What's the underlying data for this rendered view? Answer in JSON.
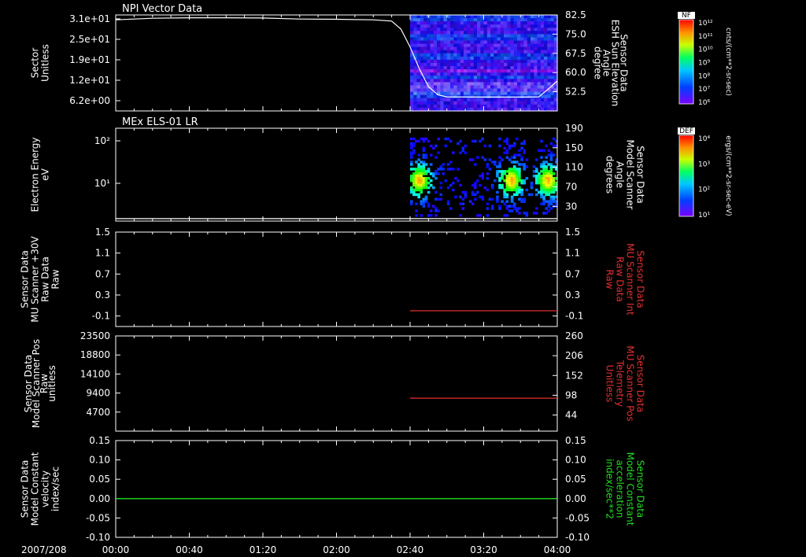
{
  "colors": {
    "background": "#000000",
    "axis": "#ffffff",
    "red": "#e03030",
    "green": "#22dd22"
  },
  "time_axis": {
    "date_label": "2007/208",
    "ticks": [
      "00:00",
      "00:40",
      "01:20",
      "02:00",
      "02:40",
      "03:20",
      "04:00"
    ]
  },
  "colorbars": [
    {
      "tag": "NF",
      "scale": "log",
      "tick_labels": [
        "10¹²",
        "10¹¹",
        "10¹⁰",
        "10⁹",
        "10⁸",
        "10⁷",
        "10⁶"
      ],
      "units": "cnts/(cm**2-sr-sec)"
    },
    {
      "tag": "DEF",
      "scale": "log",
      "tick_labels": [
        "10⁴",
        "10³",
        "10²",
        "10¹"
      ],
      "units": "ergs/(cm**2-sr-sec-eV)"
    }
  ],
  "chart_data": [
    {
      "type": "heatmap",
      "title": "NPI Vector Data",
      "left_axis": {
        "label_lines": [
          "Sector",
          "Unitless"
        ],
        "ticks": [
          "3.1e+01",
          "2.5e+01",
          "1.9e+01",
          "1.2e+01",
          "6.2e+00"
        ]
      },
      "right_axis": {
        "label_lines": [
          "Sensor Data",
          "ESH Sun Elevation",
          "Angle",
          "degree"
        ],
        "ticks": [
          "82.5",
          "75.0",
          "67.5",
          "60.0",
          "52.5"
        ],
        "ylim": [
          45.0,
          82.5
        ]
      },
      "data_start": "02:40",
      "line_series": {
        "name": "ESH Sun Elevation Angle",
        "axis": "right",
        "points": [
          [
            "00:00",
            80.6
          ],
          [
            "00:20",
            81.2
          ],
          [
            "00:40",
            81.4
          ],
          [
            "01:00",
            81.4
          ],
          [
            "01:20",
            81.3
          ],
          [
            "01:40",
            80.9
          ],
          [
            "02:00",
            80.8
          ],
          [
            "02:20",
            80.6
          ],
          [
            "02:30",
            80.1
          ],
          [
            "02:35",
            77.0
          ],
          [
            "02:40",
            70.0
          ],
          [
            "02:45",
            61.5
          ],
          [
            "02:50",
            54.5
          ],
          [
            "02:55",
            51.3
          ],
          [
            "03:00",
            50.5
          ],
          [
            "03:20",
            50.4
          ],
          [
            "03:40",
            50.4
          ],
          [
            "03:50",
            50.5
          ],
          [
            "03:55",
            53.5
          ],
          [
            "04:00",
            56.7
          ]
        ]
      }
    },
    {
      "type": "heatmap",
      "title": "MEx ELS-01 LR",
      "left_axis": {
        "label_lines": [
          "Electron Energy",
          "eV"
        ],
        "scale": "log",
        "ticks": [
          "10²",
          "10¹"
        ]
      },
      "right_axis": {
        "label_lines": [
          "Sensor Data",
          "Model Scanner",
          "Angle",
          "degrees"
        ],
        "ticks": [
          "190",
          "150",
          "110",
          "70",
          "30"
        ],
        "ylim": [
          0,
          190
        ]
      },
      "data_start": "02:40",
      "line_series": {
        "name": "Model Scanner Angle",
        "axis": "right",
        "points": [
          [
            "00:00",
            5
          ],
          [
            "04:00",
            5
          ]
        ]
      },
      "bursts": [
        "02:45",
        "03:35",
        "03:55"
      ]
    },
    {
      "type": "line",
      "left_axis": {
        "label_lines": [
          "Sensor Data",
          "MU Scanner +30V",
          "Raw Data",
          "Raw"
        ],
        "ticks": [
          "1.5",
          "1.1",
          "0.7",
          "0.3",
          "-0.1"
        ],
        "ylim": [
          -0.3,
          1.5
        ]
      },
      "right_axis": {
        "label_lines": [
          "Sensor Data",
          "MU Scanner Int",
          "Raw Data",
          "Raw"
        ],
        "ticks": [
          "1.5",
          "1.1",
          "0.7",
          "0.3",
          "-0.1"
        ],
        "ylim": [
          -0.3,
          1.5
        ]
      },
      "series": [
        {
          "axis": "right",
          "color": "red",
          "points": [
            [
              "02:40",
              0.0
            ],
            [
              "04:00",
              0.0
            ]
          ]
        }
      ]
    },
    {
      "type": "line",
      "left_axis": {
        "label_lines": [
          "Sensor Data",
          "Model Scanner Pos",
          "Raw",
          "unitless"
        ],
        "ticks": [
          "23500",
          "18800",
          "14100",
          "9400",
          "4700"
        ],
        "ylim": [
          0,
          23500
        ]
      },
      "right_axis": {
        "label_lines": [
          "Sensor Data",
          "MU Scanner Pos",
          "Telemetry",
          "Unitless"
        ],
        "ticks": [
          "260",
          "206",
          "152",
          "98",
          "44"
        ],
        "ylim": [
          0,
          260
        ]
      },
      "series": [
        {
          "axis": "right",
          "color": "red",
          "points": [
            [
              "02:40",
              90
            ],
            [
              "04:00",
              90
            ]
          ]
        }
      ]
    },
    {
      "type": "line",
      "left_axis": {
        "label_lines": [
          "Sensor Data",
          "Model Constant",
          "velocity",
          "index/sec"
        ],
        "ticks": [
          "0.15",
          "0.10",
          "0.05",
          "0.00",
          "-0.05",
          "-0.10"
        ],
        "ylim": [
          -0.1,
          0.15
        ]
      },
      "right_axis": {
        "label_lines": [
          "Sensor Data",
          "Model Constant",
          "acceleration",
          "index/sec**2"
        ],
        "ticks": [
          "0.15",
          "0.10",
          "0.05",
          "0.00",
          "-0.05",
          "-0.10"
        ],
        "ylim": [
          -0.1,
          0.15
        ]
      },
      "series": [
        {
          "axis": "left",
          "color": "green",
          "points": [
            [
              "00:00",
              0.0
            ],
            [
              "04:00",
              0.0
            ]
          ]
        }
      ]
    }
  ]
}
